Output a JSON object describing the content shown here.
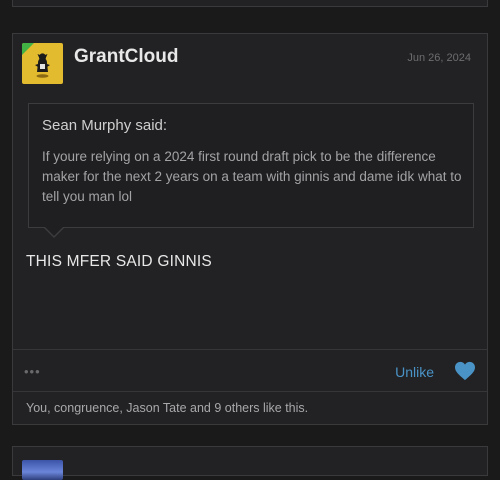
{
  "post": {
    "username": "GrantCloud",
    "date": "Jun 26, 2024",
    "quote": {
      "author": "Sean Murphy said:",
      "text": "If youre relying on a 2024 first round draft pick to be the difference maker for the next 2 years on a team with ginnis and dame idk what to tell you man lol"
    },
    "body": "THIS MFER SAID GINNIS",
    "actions": {
      "more": "•••",
      "unlike_label": "Unlike"
    },
    "likes_summary": "You, congruence, Jason Tate and 9 others like this."
  },
  "icons": {
    "more": "more-dots-icon",
    "like": "heart-icon",
    "avatar_badge": "online-indicator"
  },
  "colors": {
    "accent": "#4a93c6",
    "background": "#1a1a1b",
    "card": "#222224",
    "avatar_bg": "#e3bb2f",
    "online": "#43b244"
  }
}
